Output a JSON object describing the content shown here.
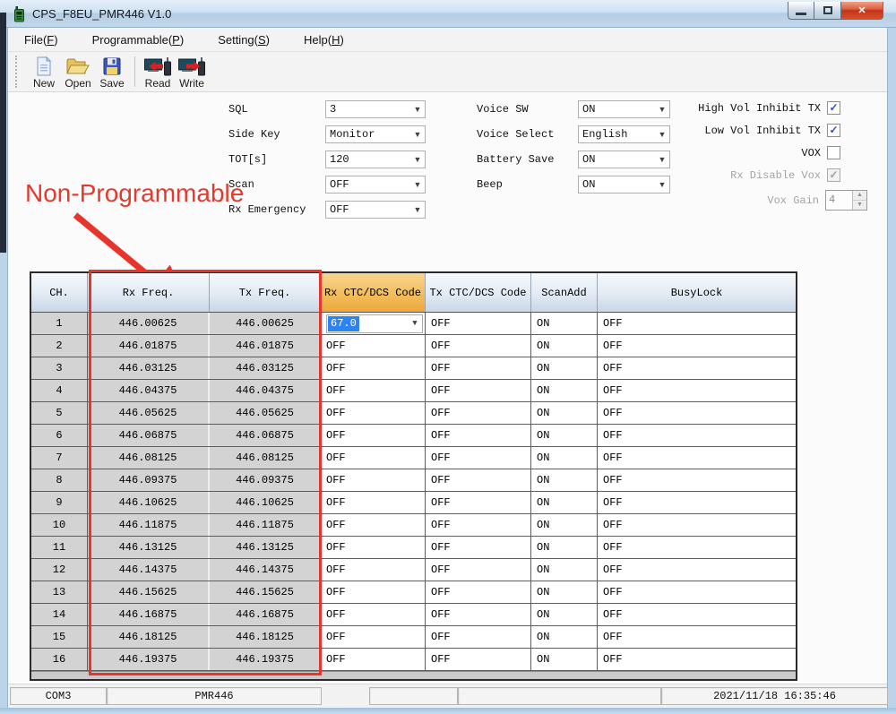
{
  "window": {
    "title": "CPS_F8EU_PMR446 V1.0",
    "controls": {
      "minimize": "minimize",
      "maximize": "maximize",
      "close": "close"
    }
  },
  "menu": {
    "items": [
      {
        "id": "file",
        "pre": "File(",
        "key": "F",
        "post": ")"
      },
      {
        "id": "programmable",
        "pre": "Programmable(",
        "key": "P",
        "post": ")"
      },
      {
        "id": "setting",
        "pre": "Setting(",
        "key": "S",
        "post": ")"
      },
      {
        "id": "help",
        "pre": "Help(",
        "key": "H",
        "post": ")"
      }
    ]
  },
  "toolbar": {
    "buttons": [
      {
        "label": "New",
        "icon": "new-document-icon"
      },
      {
        "label": "Open",
        "icon": "open-folder-icon"
      },
      {
        "label": "Save",
        "icon": "save-floppy-icon"
      },
      {
        "label": "Read",
        "icon": "read-from-radio-icon"
      },
      {
        "label": "Write",
        "icon": "write-to-radio-icon"
      }
    ]
  },
  "settings": {
    "left": [
      {
        "label": "SQL",
        "value": "3"
      },
      {
        "label": "Side Key",
        "value": "Monitor"
      },
      {
        "label": "TOT[s]",
        "value": "120"
      },
      {
        "label": "Scan",
        "value": "OFF"
      },
      {
        "label": "Rx Emergency",
        "value": "OFF"
      }
    ],
    "mid": [
      {
        "label": "Voice SW",
        "value": "ON"
      },
      {
        "label": "Voice Select",
        "value": "English"
      },
      {
        "label": "Battery Save",
        "value": "ON"
      },
      {
        "label": "Beep",
        "value": "ON"
      }
    ],
    "checkboxes": [
      {
        "label": "High Vol Inhibit TX",
        "checked": true,
        "enabled": true
      },
      {
        "label": "Low Vol Inhibit TX",
        "checked": true,
        "enabled": true
      },
      {
        "label": "VOX",
        "checked": false,
        "enabled": true
      },
      {
        "label": "Rx Disable Vox",
        "checked": true,
        "enabled": false
      }
    ],
    "vox_gain": {
      "label": "Vox Gain",
      "value": "4",
      "enabled": false
    }
  },
  "annotation": {
    "text": "Non-Programmable",
    "color": "#e23b2e"
  },
  "table": {
    "headers": [
      "CH.",
      "Rx Freq.",
      "Tx Freq.",
      "Rx CTC/DCS Code",
      "Tx CTC/DCS Code",
      "ScanAdd",
      "BusyLock"
    ],
    "highlighted_header": "Rx CTC/DCS Code",
    "selected_cell": {
      "row": 1,
      "column": "Rx CTC/DCS Code",
      "value": "67.0"
    },
    "rows": [
      {
        "ch": "1",
        "rx": "446.00625",
        "tx": "446.00625",
        "rx_code": "67.0",
        "tx_code": "OFF",
        "scan_add": "ON",
        "busy_lock": "OFF"
      },
      {
        "ch": "2",
        "rx": "446.01875",
        "tx": "446.01875",
        "rx_code": "OFF",
        "tx_code": "OFF",
        "scan_add": "ON",
        "busy_lock": "OFF"
      },
      {
        "ch": "3",
        "rx": "446.03125",
        "tx": "446.03125",
        "rx_code": "OFF",
        "tx_code": "OFF",
        "scan_add": "ON",
        "busy_lock": "OFF"
      },
      {
        "ch": "4",
        "rx": "446.04375",
        "tx": "446.04375",
        "rx_code": "OFF",
        "tx_code": "OFF",
        "scan_add": "ON",
        "busy_lock": "OFF"
      },
      {
        "ch": "5",
        "rx": "446.05625",
        "tx": "446.05625",
        "rx_code": "OFF",
        "tx_code": "OFF",
        "scan_add": "ON",
        "busy_lock": "OFF"
      },
      {
        "ch": "6",
        "rx": "446.06875",
        "tx": "446.06875",
        "rx_code": "OFF",
        "tx_code": "OFF",
        "scan_add": "ON",
        "busy_lock": "OFF"
      },
      {
        "ch": "7",
        "rx": "446.08125",
        "tx": "446.08125",
        "rx_code": "OFF",
        "tx_code": "OFF",
        "scan_add": "ON",
        "busy_lock": "OFF"
      },
      {
        "ch": "8",
        "rx": "446.09375",
        "tx": "446.09375",
        "rx_code": "OFF",
        "tx_code": "OFF",
        "scan_add": "ON",
        "busy_lock": "OFF"
      },
      {
        "ch": "9",
        "rx": "446.10625",
        "tx": "446.10625",
        "rx_code": "OFF",
        "tx_code": "OFF",
        "scan_add": "ON",
        "busy_lock": "OFF"
      },
      {
        "ch": "10",
        "rx": "446.11875",
        "tx": "446.11875",
        "rx_code": "OFF",
        "tx_code": "OFF",
        "scan_add": "ON",
        "busy_lock": "OFF"
      },
      {
        "ch": "11",
        "rx": "446.13125",
        "tx": "446.13125",
        "rx_code": "OFF",
        "tx_code": "OFF",
        "scan_add": "ON",
        "busy_lock": "OFF"
      },
      {
        "ch": "12",
        "rx": "446.14375",
        "tx": "446.14375",
        "rx_code": "OFF",
        "tx_code": "OFF",
        "scan_add": "ON",
        "busy_lock": "OFF"
      },
      {
        "ch": "13",
        "rx": "446.15625",
        "tx": "446.15625",
        "rx_code": "OFF",
        "tx_code": "OFF",
        "scan_add": "ON",
        "busy_lock": "OFF"
      },
      {
        "ch": "14",
        "rx": "446.16875",
        "tx": "446.16875",
        "rx_code": "OFF",
        "tx_code": "OFF",
        "scan_add": "ON",
        "busy_lock": "OFF"
      },
      {
        "ch": "15",
        "rx": "446.18125",
        "tx": "446.18125",
        "rx_code": "OFF",
        "tx_code": "OFF",
        "scan_add": "ON",
        "busy_lock": "OFF"
      },
      {
        "ch": "16",
        "rx": "446.19375",
        "tx": "446.19375",
        "rx_code": "OFF",
        "tx_code": "OFF",
        "scan_add": "ON",
        "busy_lock": "OFF"
      }
    ]
  },
  "status_bar": {
    "com_port": "COM3",
    "model": "PMR446",
    "datetime": "2021/11/18 16:35:46"
  },
  "colors": {
    "annotation_red": "#e8352b",
    "header_orange": "#f2bd5c",
    "header_blue": "#dbe5f1",
    "selection_blue": "#2f83f0",
    "readonly_cell_gray": "#d3d3d3",
    "close_button_red": "#c23317",
    "check_blue": "#4048c0"
  }
}
